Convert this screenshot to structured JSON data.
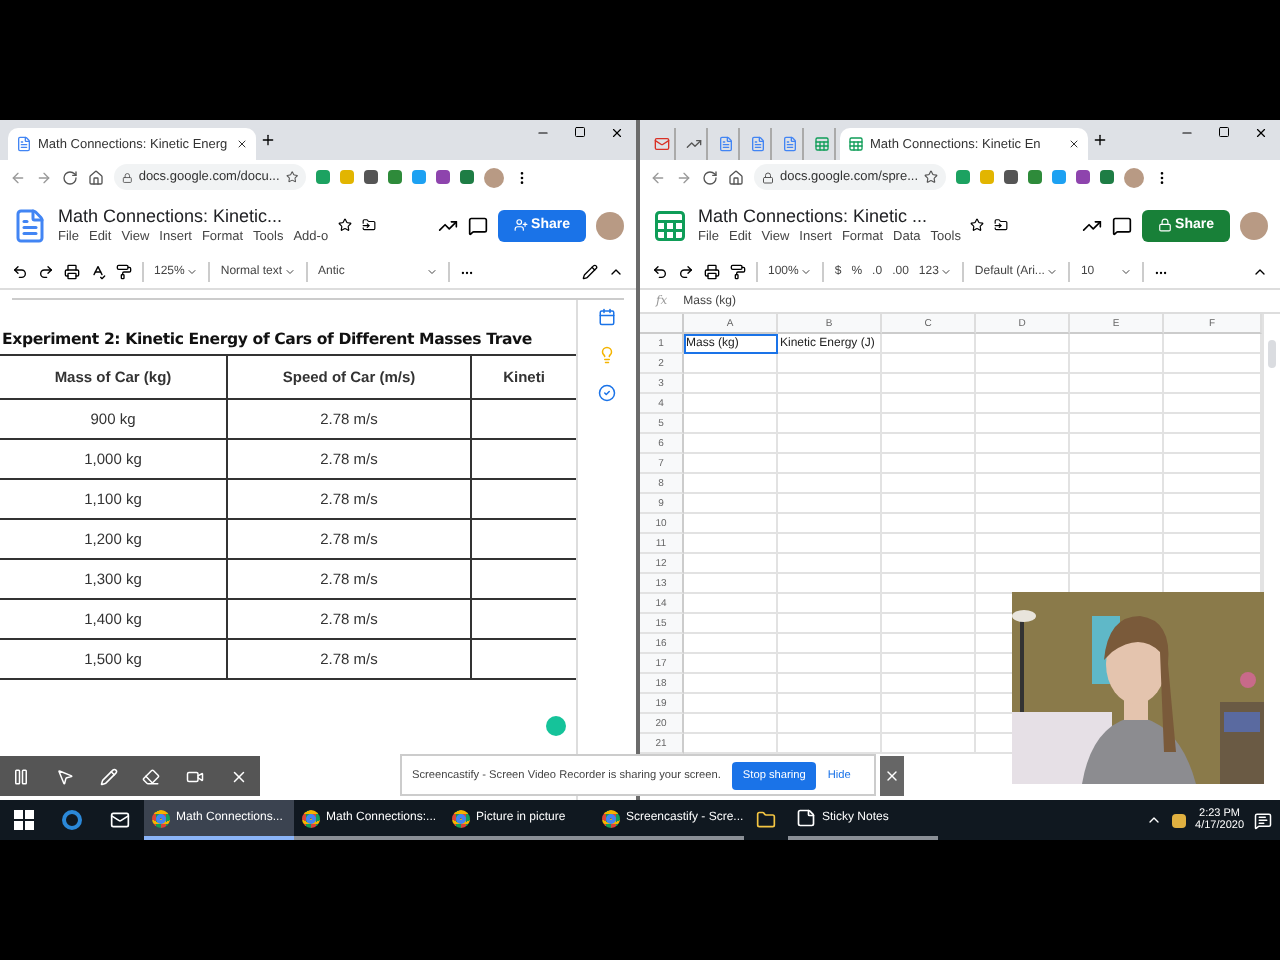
{
  "docs_window": {
    "tab_title": "Math Connections: Kinetic Energ",
    "address": "docs.google.com/docu...",
    "doc_title": "Math Connections: Kinetic...",
    "menu": [
      "File",
      "Edit",
      "View",
      "Insert",
      "Format",
      "Tools",
      "Add-o"
    ],
    "share": "Share",
    "toolbar": {
      "zoom": "125%",
      "style": "Normal text",
      "font": "Antic"
    },
    "table_title": "Experiment 2: Kinetic Energy of Cars of Different Masses Trave",
    "columns": [
      "Mass of Car (kg)",
      "Speed of Car (m/s)",
      "Kineti"
    ],
    "rows": [
      [
        "900 kg",
        "2.78 m/s"
      ],
      [
        "1,000 kg",
        "2.78 m/s"
      ],
      [
        "1,100 kg",
        "2.78 m/s"
      ],
      [
        "1,200 kg",
        "2.78 m/s"
      ],
      [
        "1,300 kg",
        "2.78 m/s"
      ],
      [
        "1,400 kg",
        "2.78 m/s"
      ],
      [
        "1,500 kg",
        "2.78 m/s"
      ]
    ]
  },
  "sheets_window": {
    "icon_tabs": [
      {
        "kind": "mail"
      },
      {
        "kind": "chart"
      },
      {
        "kind": "doc"
      },
      {
        "kind": "doc"
      },
      {
        "kind": "doc"
      },
      {
        "kind": "sheet"
      }
    ],
    "tab_title": "Math Connections: Kinetic En",
    "address": "docs.google.com/spre...",
    "doc_title": "Math Connections: Kinetic ...",
    "menu": [
      "File",
      "Edit",
      "View",
      "Insert",
      "Format",
      "Data",
      "Tools"
    ],
    "share": "Share",
    "toolbar": {
      "zoom": "100%",
      "currency": "$",
      "percent": "%",
      "decimal_less": ".0",
      "decimal_more": ".00",
      "formats": "123",
      "font": "Default (Ari...",
      "size": "10"
    },
    "formula_label": "fx",
    "formula": "Mass (kg)",
    "columns": [
      "A",
      "B",
      "C",
      "D",
      "E",
      "F"
    ],
    "rows": [
      {
        "number": "1",
        "cells": [
          {
            "text": "Mass (kg)",
            "selected": true
          },
          {
            "text": "Kinetic Energy (J)",
            "selected": false
          }
        ]
      },
      {
        "number": "2"
      },
      {
        "number": "3"
      },
      {
        "number": "4"
      },
      {
        "number": "5"
      },
      {
        "number": "6"
      },
      {
        "number": "7"
      },
      {
        "number": "8"
      },
      {
        "number": "9"
      },
      {
        "number": "10"
      },
      {
        "number": "11"
      },
      {
        "number": "12"
      },
      {
        "number": "13"
      },
      {
        "number": "14"
      },
      {
        "number": "15"
      },
      {
        "number": "16"
      },
      {
        "number": "17"
      },
      {
        "number": "18"
      },
      {
        "number": "19"
      },
      {
        "number": "20"
      },
      {
        "number": "21"
      }
    ]
  },
  "sharing_bar": {
    "message": "Screencastify - Screen Video Recorder is sharing your screen.",
    "stop": "Stop sharing",
    "hide": "Hide"
  },
  "taskbar": {
    "items": [
      {
        "kind": "chrome",
        "label": "Math Connections...",
        "selected": true
      },
      {
        "kind": "chrome",
        "label": "Math Connections:...",
        "selected": false
      },
      {
        "kind": "chrome",
        "label": "Picture in picture",
        "selected": false
      },
      {
        "kind": "chrome",
        "label": "Screencastify - Scre...",
        "selected": false
      },
      {
        "kind": "folder",
        "selected": false
      },
      {
        "kind": "sticky",
        "label": "Sticky Notes",
        "selected": false
      }
    ],
    "time": "2:23 PM",
    "date": "4/17/2020"
  }
}
